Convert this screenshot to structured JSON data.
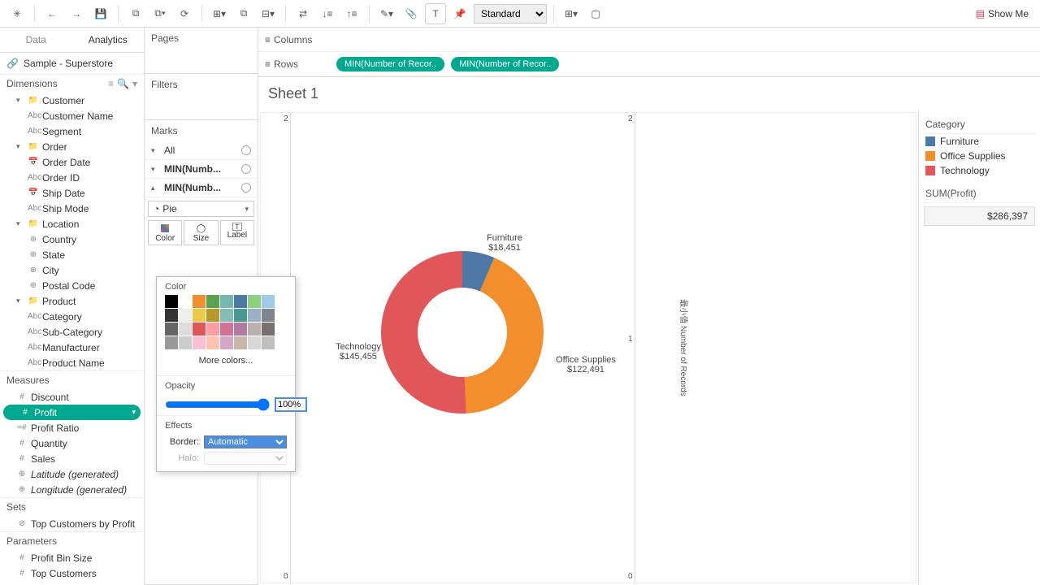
{
  "toolbar": {
    "fit": "Standard",
    "showme": "Show Me"
  },
  "tabs": {
    "data": "Data",
    "analytics": "Analytics"
  },
  "datasource": "Sample - Superstore",
  "dimensions_label": "Dimensions",
  "measures_label": "Measures",
  "sets_label": "Sets",
  "parameters_label": "Parameters",
  "dimensions": {
    "customer": {
      "label": "Customer",
      "name": "Customer Name",
      "segment": "Segment"
    },
    "order": {
      "label": "Order",
      "date": "Order Date",
      "id": "Order ID",
      "shipdate": "Ship Date",
      "shipmode": "Ship Mode"
    },
    "location": {
      "label": "Location",
      "country": "Country",
      "state": "State",
      "city": "City",
      "postal": "Postal Code"
    },
    "product": {
      "label": "Product",
      "category": "Category",
      "subcat": "Sub-Category",
      "manufacturer": "Manufacturer",
      "name": "Product Name"
    }
  },
  "measures": {
    "discount": "Discount",
    "profit": "Profit",
    "profitratio": "Profit Ratio",
    "quantity": "Quantity",
    "sales": "Sales",
    "lat": "Latitude (generated)",
    "lon": "Longitude (generated)"
  },
  "sets": {
    "top": "Top Customers by Profit"
  },
  "params": {
    "bin": "Profit Bin Size",
    "top": "Top Customers"
  },
  "shelves": {
    "pages": "Pages",
    "filters": "Filters",
    "marks": "Marks",
    "columns": "Columns",
    "rows": "Rows",
    "all": "All",
    "m1": "MIN(Numb...",
    "m2": "MIN(Numb...",
    "pie": "Pie",
    "color": "Color",
    "size": "Size",
    "label": "Label",
    "pill1": "MIN(Number of Recor..",
    "pill2": "MIN(Number of Recor.."
  },
  "popup": {
    "color": "Color",
    "more": "More colors...",
    "opacity": "Opacity",
    "opval": "100%",
    "effects": "Effects",
    "border": "Border:",
    "halo": "Halo:",
    "auto": "Automatic"
  },
  "sheet_title": "Sheet 1",
  "axis": {
    "t2a": "2",
    "t2b": "2",
    "t1": "1",
    "t0a": "0",
    "t0b": "0",
    "ylabel": "最小值 Number of Records"
  },
  "chart_data": {
    "type": "pie",
    "title": "Sheet 1",
    "series": [
      {
        "name": "Furniture",
        "value": 18451,
        "label": "$18,451",
        "color": "#4e79a7"
      },
      {
        "name": "Office Supplies",
        "value": 122491,
        "label": "$122,491",
        "color": "#f28e2b"
      },
      {
        "name": "Technology",
        "value": 145455,
        "label": "$145,455",
        "color": "#e15759"
      }
    ],
    "total_label": "SUM(Profit)",
    "total": "$286,397",
    "inner_radius": 0.55
  },
  "legend": {
    "category": "Category",
    "items": [
      {
        "name": "Furniture",
        "color": "#4e79a7"
      },
      {
        "name": "Office Supplies",
        "color": "#f28e2b"
      },
      {
        "name": "Technology",
        "color": "#e15759"
      }
    ],
    "sum_label": "SUM(Profit)",
    "sum_value": "$286,397"
  }
}
